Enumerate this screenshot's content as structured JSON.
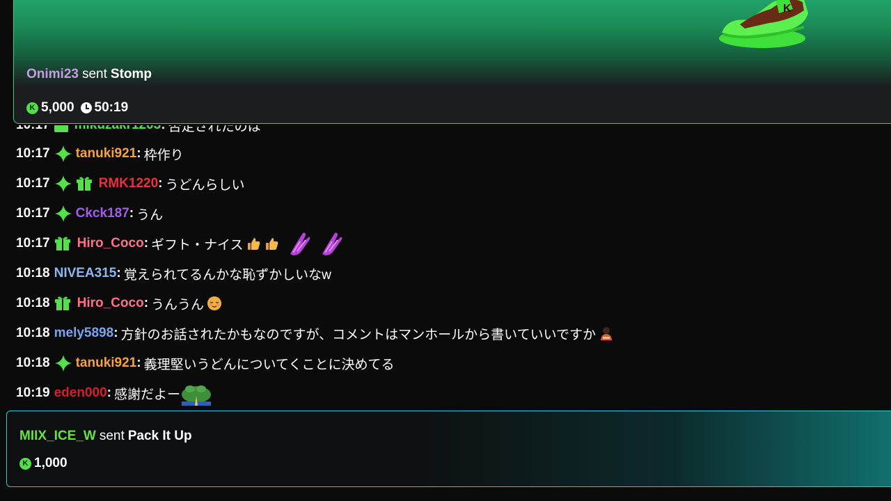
{
  "pinned_gift": {
    "username": "Onimi23",
    "sent_word": "sent",
    "gift_name": "Stomp",
    "coin_symbol": "K",
    "amount": "5,000",
    "time_left": "50:19"
  },
  "chat": {
    "messages": [
      {
        "time": "10:17",
        "badges": [
          "star-badge"
        ],
        "user": "tanuki921",
        "user_color": "#f7a23a",
        "text": "枠作り",
        "emotes": []
      },
      {
        "time": "10:17",
        "badges": [
          "star-badge",
          "gift-badge"
        ],
        "user": "RMK1220",
        "user_color": "#e8303f",
        "text": "うどんらしい",
        "emotes": []
      },
      {
        "time": "10:17",
        "badges": [
          "star-badge"
        ],
        "user": "Ckck187",
        "user_color": "#a35bf0",
        "text": "うん",
        "emotes": []
      },
      {
        "time": "10:17",
        "badges": [
          "gift-badge"
        ],
        "user": "Hiro_Coco",
        "user_color": "#ff6f86",
        "text": "ギフト・ナイス",
        "emotes": [
          "thumbs-up",
          "thumbs-up",
          "praying-hands",
          "praying-hands"
        ]
      },
      {
        "time": "10:18",
        "badges": [],
        "user": "NIVEA315",
        "user_color": "#8fb6f0",
        "text": "覚えられてるんかな恥ずかしいなw",
        "emotes": []
      },
      {
        "time": "10:18",
        "badges": [
          "gift-badge"
        ],
        "user": "Hiro_Coco",
        "user_color": "#ff6f86",
        "text": "うんうん",
        "emotes": [
          "relieved-face"
        ]
      },
      {
        "time": "10:18",
        "badges": [],
        "user": "mely5898",
        "user_color": "#7aa4ef",
        "text": "方針のお話されたかもなのですが、コメントはマンホールから書いていいですか",
        "emotes": [
          "bowing-person"
        ]
      },
      {
        "time": "10:18",
        "badges": [
          "star-badge"
        ],
        "user": "tanuki921",
        "user_color": "#f7a23a",
        "text": "義理堅いうどんについてくことに決めてる",
        "emotes": []
      },
      {
        "time": "10:19",
        "badges": [],
        "user": "eden000",
        "user_color": "#d41f2e",
        "text": "感謝だよー",
        "emotes": [
          "frog-praying"
        ]
      }
    ]
  },
  "bottom_gift": {
    "username": "MIIX_ICE_W",
    "sent_word": "sent",
    "gift_name": "Pack It Up",
    "coin_symbol": "K",
    "amount": "1,000"
  },
  "colors": {
    "kick_green": "#53e04a",
    "pinned_border": "#29d18a",
    "bottom_border": "#30c7c7",
    "background": "#0b0b0c"
  }
}
